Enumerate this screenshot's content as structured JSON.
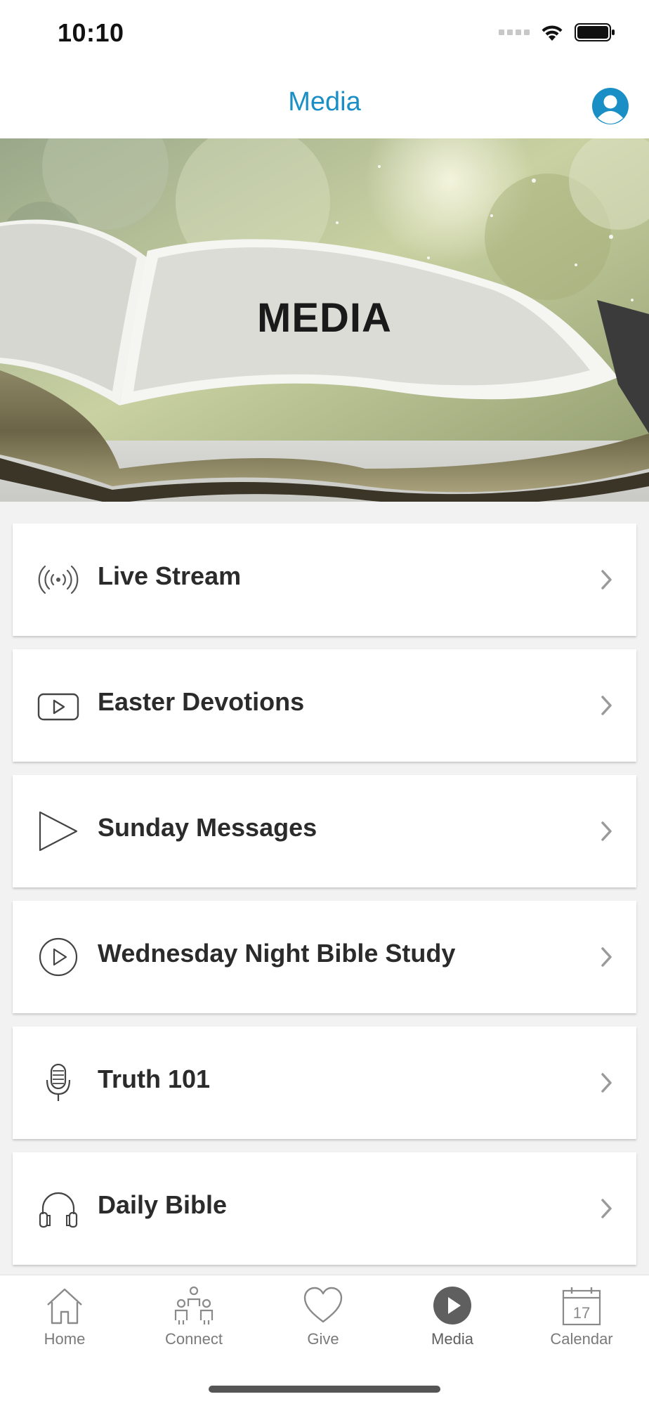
{
  "status_bar": {
    "time": "10:10"
  },
  "nav": {
    "title": "Media"
  },
  "hero": {
    "title": "MEDIA"
  },
  "menu": [
    {
      "label": "Live Stream",
      "icon": "broadcast-icon"
    },
    {
      "label": "Easter Devotions",
      "icon": "video-player-icon"
    },
    {
      "label": "Sunday Messages",
      "icon": "play-triangle-icon"
    },
    {
      "label": "Wednesday Night Bible Study",
      "icon": "play-circle-icon"
    },
    {
      "label": "Truth 101",
      "icon": "microphone-icon"
    },
    {
      "label": "Daily Bible",
      "icon": "headphones-icon"
    }
  ],
  "tabs": [
    {
      "label": "Home",
      "icon": "home-icon",
      "active": false
    },
    {
      "label": "Connect",
      "icon": "people-icon",
      "active": false
    },
    {
      "label": "Give",
      "icon": "heart-icon",
      "active": false
    },
    {
      "label": "Media",
      "icon": "play-circle-filled-icon",
      "active": true
    },
    {
      "label": "Calendar",
      "icon": "calendar-icon",
      "active": false
    }
  ],
  "calendar_day": "17",
  "colors": {
    "accent": "#1a8fc6",
    "icon_gray": "#7a7a7a",
    "active_tab": "#5f5f5f"
  }
}
